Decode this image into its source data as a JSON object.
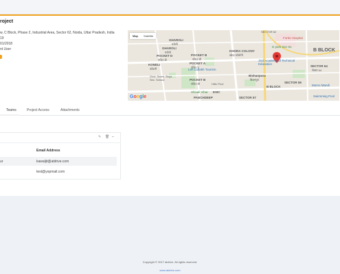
{
  "project": {
    "title": "roject",
    "address": "w, C Block, Phase 2, Industrial Area, Sector 62, Noida, Uttar Pradesh, India",
    "line2": "19",
    "date": "01/2018",
    "user": "nt User"
  },
  "map": {
    "btn_map": "Map",
    "btn_satellite": "Satellite",
    "labels": {
      "gharoli": "GHAROLI",
      "gharoli_hi": "घरोली",
      "gharoli2": "GHAROLI",
      "gharoli2_hi": "घरोली",
      "khora": "KHORA COLONY",
      "khora_hi": "खोड़ा कॉलोनी",
      "pocket_d": "POCKET D",
      "pocket_d_hi": "पॉकेट डी",
      "pocket_b": "POCKET B",
      "pocket_b_hi": "पॉकेट बी",
      "pocket_a": "POCKET A",
      "pocket_a_hi": "पॉकेट ए",
      "pocket_b2": "POCKET B",
      "pocket_b2_hi": "पॉकेट बी",
      "kondli": "KONDLI",
      "kondli_hi": "कोंडली",
      "lehladakh": "Leh Ladakh Tourism",
      "govt_school": "Govt. Sarvo. Boys Sec. School",
      "hdfc": "Hdfc Pool",
      "vihar": "Shivali Vihar",
      "esic": "ESIC",
      "panchdeep": "PANCHDEEP",
      "bishanpura": "Bishanpura",
      "bishanpura_hi": "बिशनपुरा",
      "jss": "JSS Academy of Technical Education",
      "fortis": "Fortis Hospital",
      "dpark": "D park Sec-61",
      "bblock_big": "B BLOCK",
      "sector64": "SECTOR 64",
      "sector64_hi": "सेक्टर 64",
      "bblock": "B BLOCK",
      "sector59": "SECTOR 59",
      "sector57": "SECTOR 57",
      "sector62": "SECTOR 62",
      "momo": "Momo Mandi",
      "swimming": "Swimming Pool"
    }
  },
  "tabs": [
    "Teams",
    "Project Access",
    "Attachments"
  ],
  "table": {
    "col_email": "Email Address",
    "rows": [
      {
        "name": "ur",
        "email": "kawaljit@atdrive.com"
      },
      {
        "name": "",
        "email": "test@yopmail.com"
      }
    ]
  },
  "footer": {
    "copyright": "Copyright © 2017 atdrive. All rights reserved.",
    "link": "www.atdrive.com"
  },
  "colors": {
    "accent": "#f0a01e",
    "link": "#4a7bd0",
    "marker": "#e53935"
  }
}
